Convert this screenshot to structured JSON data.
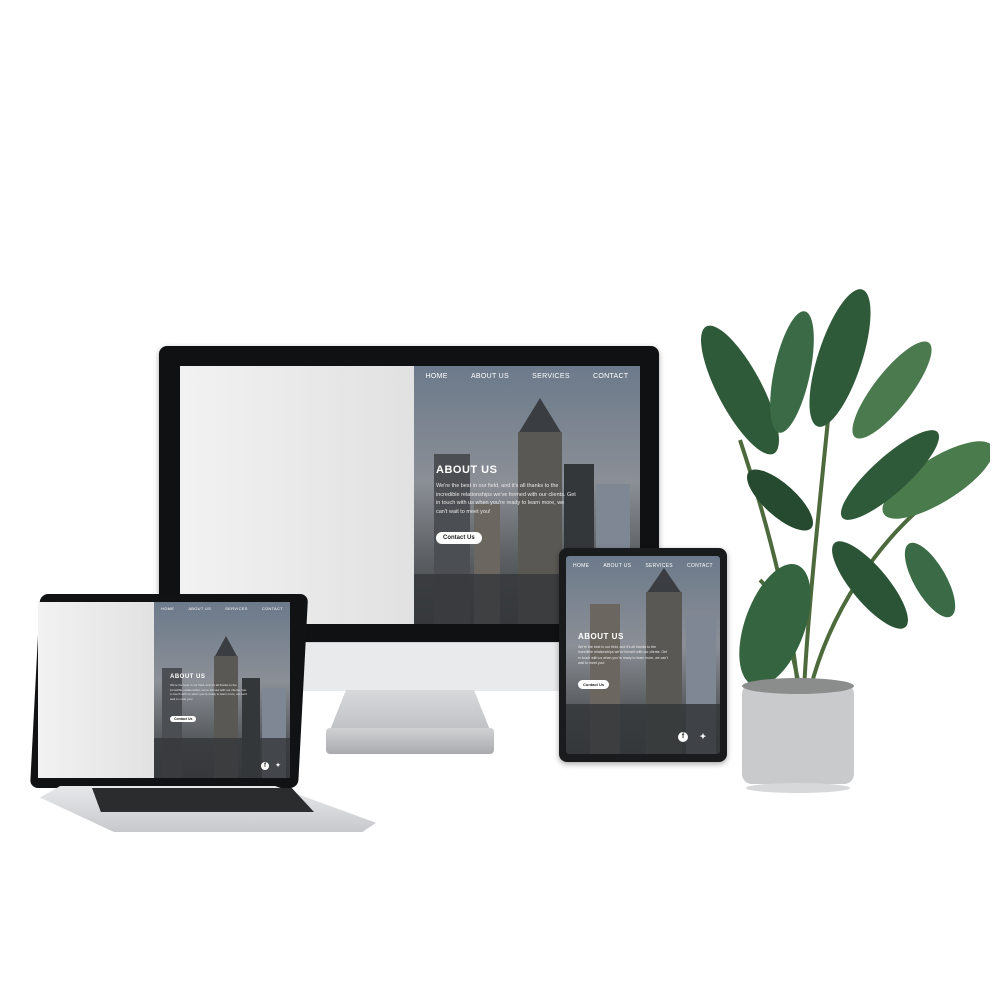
{
  "site": {
    "nav": [
      "HOME",
      "ABOUT US",
      "SERVICES",
      "CONTACT"
    ],
    "heading": "ABOUT US",
    "body": "We're the best in our field, and it's all thanks to the incredible relationships we've formed with our clients. Get in touch with us when you're ready to learn more, we can't wait to meet you!",
    "button_label": "Contact Us",
    "social_icons": [
      "facebook-icon",
      "twitter-icon"
    ]
  },
  "colors": {
    "device_frame": "#101112",
    "plant_leaf": "#2f5a3a",
    "pot": "#c9cacb"
  }
}
